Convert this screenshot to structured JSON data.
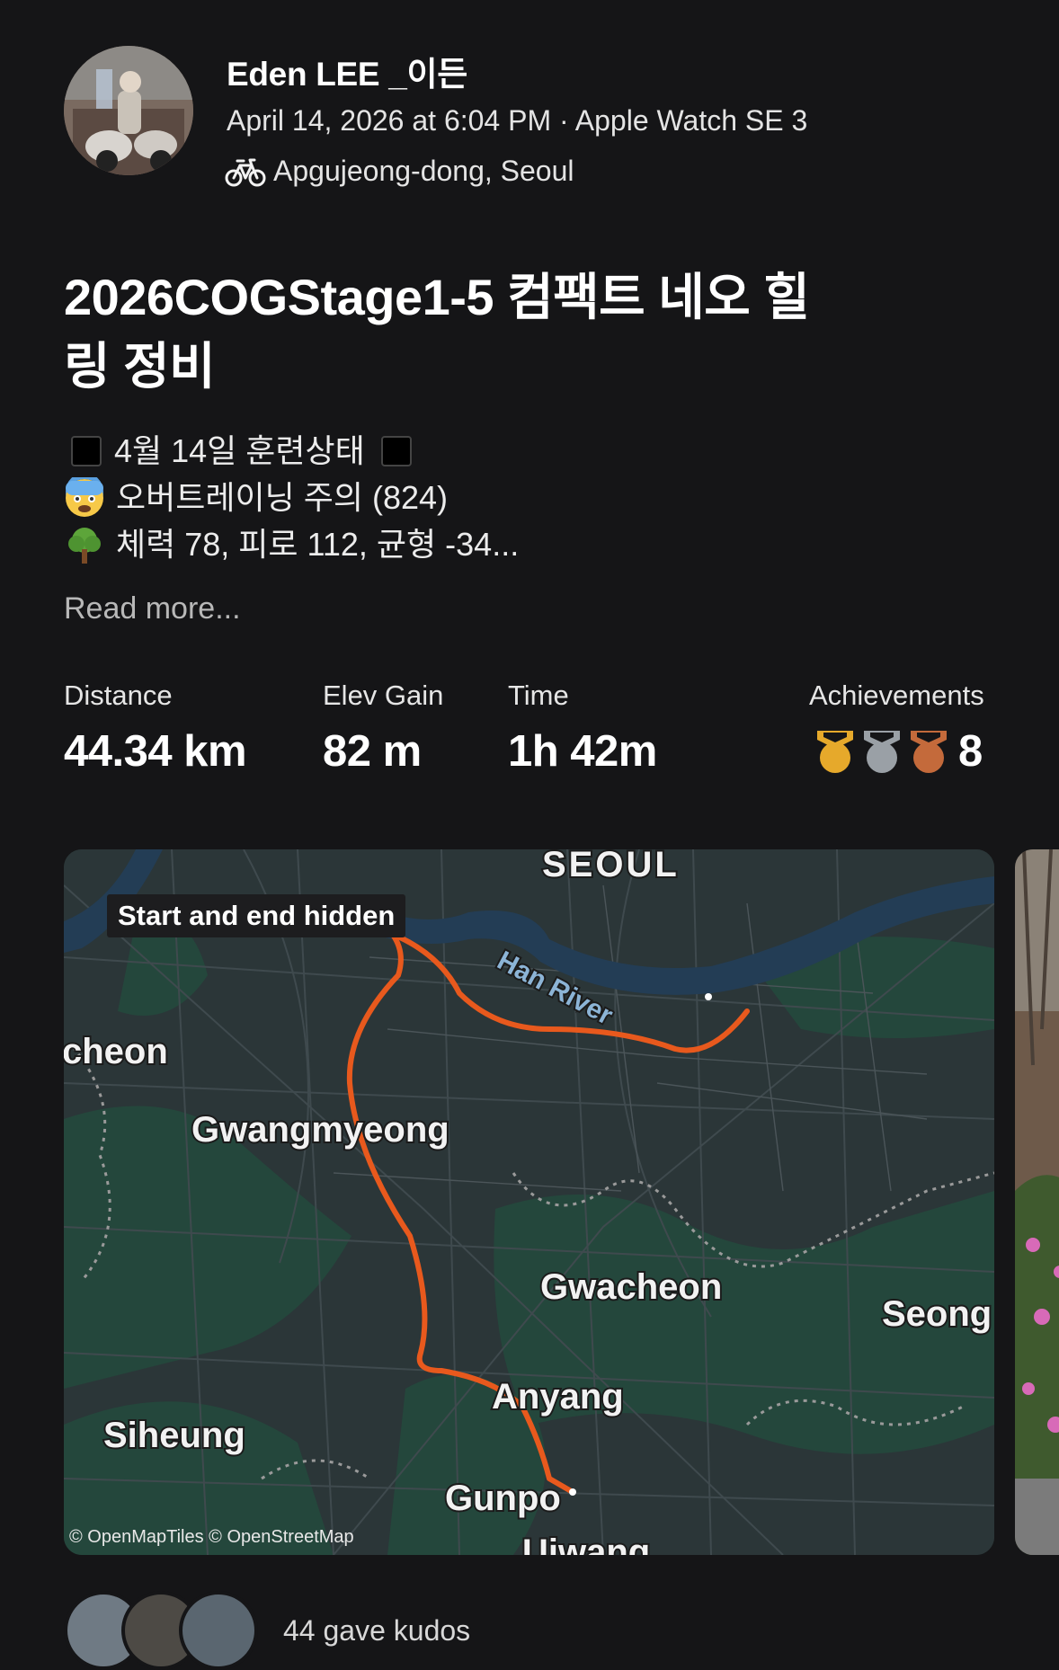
{
  "athlete": {
    "name": "Eden LEE _이든",
    "datetime": "April 14, 2026 at 6:04 PM",
    "device": "Apple Watch SE 3",
    "location": "Apgujeong-dong, Seoul",
    "activity_icon": "bicycle-icon"
  },
  "activity": {
    "title": "2026COGStage1-5 컴팩트 네오 힐링 정비",
    "description_lines": [
      "4월 14일 훈련상태",
      "오버트레이닝 주의 (824)",
      "체력 78, 피로 112, 균형 -34..."
    ],
    "read_more": "Read more..."
  },
  "stats": {
    "distance": {
      "label": "Distance",
      "value": "44.34 km"
    },
    "elev_gain": {
      "label": "Elev Gain",
      "value": "82 m"
    },
    "time": {
      "label": "Time",
      "value": "1h 42m"
    },
    "achievements": {
      "label": "Achievements",
      "count": "8",
      "medals": [
        "gold",
        "silver",
        "bronze"
      ]
    }
  },
  "map": {
    "privacy_badge": "Start and end hidden",
    "attribution": "© OpenMapTiles © OpenStreetMap",
    "labels": {
      "seoul": "SEOUL",
      "han_river": "Han River",
      "bucheon": "cheon",
      "gwangmyeong": "Gwangmyeong",
      "gwacheon": "Gwacheon",
      "seongnam": "Seong",
      "anyang": "Anyang",
      "siheung": "Siheung",
      "gunpo": "Gunpo",
      "uiwang": "Uiwang"
    },
    "route_color": "#e8591d"
  },
  "kudos": {
    "text": "44 gave kudos"
  },
  "colors": {
    "background": "#151517",
    "text": "#ffffff",
    "accent": "#e8591d"
  }
}
